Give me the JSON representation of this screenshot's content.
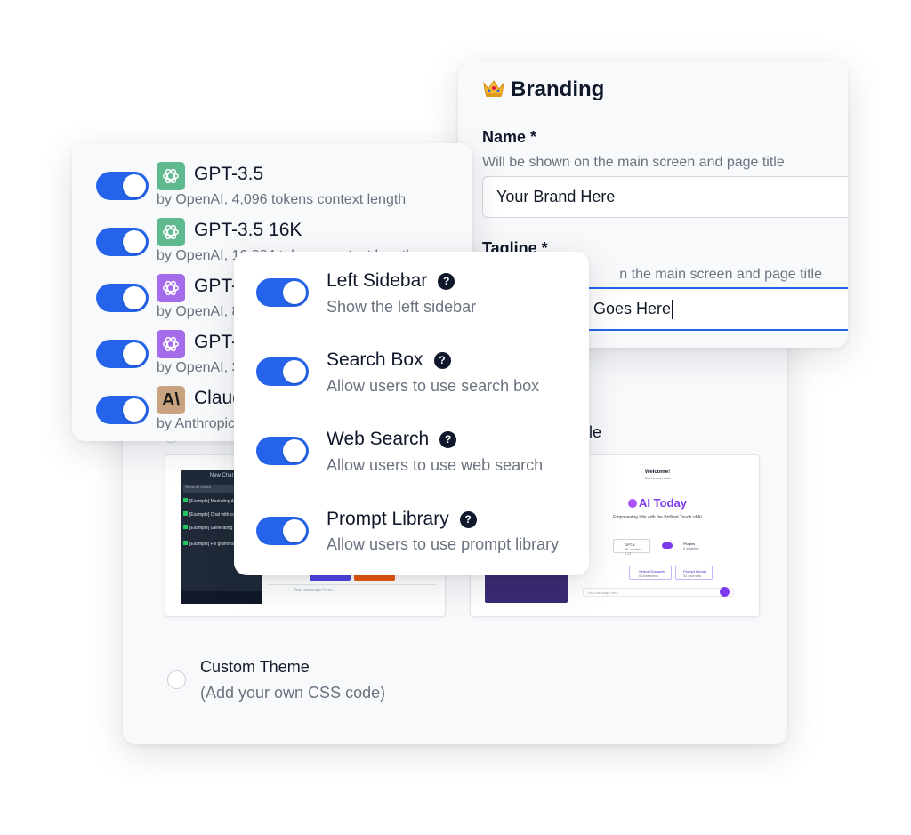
{
  "theme_card": {
    "partial_label": "ple",
    "custom_theme": {
      "label": "Custom Theme",
      "sub": "(Add your own CSS code)"
    },
    "dark_preview": {
      "new_chat": "New Chat",
      "search": "Search chats",
      "chats": [
        "[Example] Marketing Advi",
        "[Example] Chat with comp",
        "[Example] Generating dom",
        "[Example] Fix grammar an"
      ],
      "input_placeholder": "Your message here..."
    },
    "light_preview": {
      "welcome": "Welcome!",
      "welcome_sub": "Start a new chat",
      "logo_text": "AI Today",
      "tagline": "Empowering Life with the Brilliant Touch of AI",
      "model_chip": "GPT-4",
      "model_chip_sub": "8K context, 0.1T",
      "plugins": "Plugins",
      "plugins_sub": "0 enabled",
      "select_character": "Select Character",
      "select_character_sub": "0 characters",
      "prompt_library": "Prompt Library",
      "prompt_library_sub": "52 prompts",
      "input_placeholder": "Your message here..."
    }
  },
  "branding": {
    "icon": "crown-emoji",
    "title": "Branding",
    "name_label": "Name *",
    "name_help": "Will be shown on the main screen and page title",
    "name_value": "Your Brand Here",
    "tagline_label": "Tagline *",
    "tagline_help": "n the main screen and page title",
    "tagline_value": "Goes Here"
  },
  "models": [
    {
      "name": "GPT-3.5",
      "sub": "by OpenAI, 4,096 tokens context length",
      "logo": "openai-green",
      "enabled": true
    },
    {
      "name": "GPT-3.5 16K",
      "sub": "by OpenAI, 16,384 tokens context length",
      "logo": "openai-green",
      "enabled": true
    },
    {
      "name": "GPT-4",
      "sub": "by OpenAI, 8,192 tokens context length",
      "logo": "openai-purple",
      "enabled": true
    },
    {
      "name": "GPT-4 32K",
      "sub": "by OpenAI, 32,768 tokens context length",
      "logo": "openai-purple",
      "enabled": true
    },
    {
      "name": "Claude",
      "sub": "by Anthropic",
      "logo": "anthropic",
      "enabled": true
    }
  ],
  "settings": [
    {
      "title": "Left Sidebar",
      "desc": "Show the left sidebar",
      "enabled": true
    },
    {
      "title": "Search Box",
      "desc": "Allow users to use search box",
      "enabled": true
    },
    {
      "title": "Web Search",
      "desc": "Allow users to use web search",
      "enabled": true
    },
    {
      "title": "Prompt Library",
      "desc": "Allow users to use prompt library",
      "enabled": true
    }
  ],
  "help_glyph": "?",
  "colors": {
    "accent": "#2563eb",
    "openai_green": "#5fb98f",
    "openai_purple": "#a46bea",
    "anthropic": "#c9a37f",
    "ai_today_purple": "#7c3aed"
  }
}
